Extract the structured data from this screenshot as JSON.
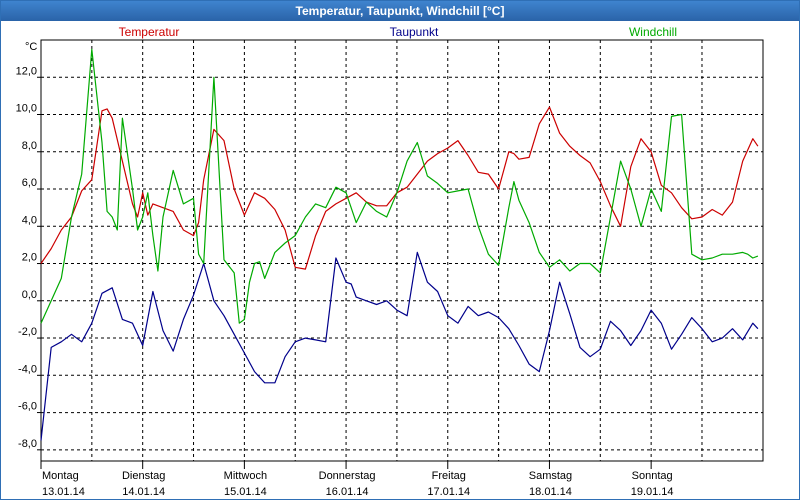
{
  "window": {
    "title": "Temperatur, Taupunkt, Windchill [°C]"
  },
  "chart_data": {
    "type": "line",
    "title": "Temperatur, Taupunkt, Windchill [°C]",
    "ylabel": "°C",
    "ylim": [
      -8.6,
      14.0
    ],
    "yticks": [
      "12,0",
      "10,0",
      "8,0",
      "6,0",
      "4,0",
      "2,0",
      "0,0",
      "-2,0",
      "-4,0",
      "-6,0",
      "-8,0"
    ],
    "ytick_values": [
      12,
      10,
      8,
      6,
      4,
      2,
      0,
      -2,
      -4,
      -6,
      -8
    ],
    "x_days": [
      "Montag",
      "Dienstag",
      "Mittwoch",
      "Donnerstag",
      "Freitag",
      "Samstag",
      "Sonntag"
    ],
    "x_dates": [
      "13.01.14",
      "14.01.14",
      "15.01.14",
      "16.01.14",
      "17.01.14",
      "18.01.14",
      "19.01.14"
    ],
    "xlim": [
      0,
      7.1
    ],
    "grid": true,
    "series": [
      {
        "name": "Temperatur",
        "color": "#cc0000",
        "x": [
          0,
          0.1,
          0.2,
          0.3,
          0.4,
          0.5,
          0.6,
          0.65,
          0.7,
          0.8,
          0.9,
          0.95,
          1.0,
          1.05,
          1.1,
          1.2,
          1.3,
          1.4,
          1.5,
          1.55,
          1.6,
          1.7,
          1.8,
          1.9,
          2.0,
          2.1,
          2.2,
          2.3,
          2.4,
          2.5,
          2.6,
          2.7,
          2.8,
          2.9,
          3.0,
          3.1,
          3.2,
          3.3,
          3.4,
          3.5,
          3.6,
          3.7,
          3.8,
          3.9,
          4.0,
          4.1,
          4.2,
          4.3,
          4.4,
          4.5,
          4.6,
          4.65,
          4.7,
          4.8,
          4.9,
          5.0,
          5.1,
          5.2,
          5.3,
          5.4,
          5.5,
          5.6,
          5.7,
          5.8,
          5.9,
          6.0,
          6.1,
          6.2,
          6.3,
          6.4,
          6.5,
          6.6,
          6.7,
          6.8,
          6.9,
          7.0,
          7.05
        ],
        "y": [
          2.0,
          2.8,
          3.8,
          4.5,
          5.9,
          6.5,
          10.2,
          10.3,
          9.8,
          7.5,
          5.2,
          4.5,
          5.8,
          4.6,
          5.2,
          5.0,
          4.8,
          3.8,
          3.5,
          4.2,
          6.5,
          9.2,
          8.6,
          6.0,
          4.6,
          5.8,
          5.5,
          4.9,
          3.8,
          1.8,
          1.7,
          3.5,
          4.8,
          5.2,
          5.5,
          5.8,
          5.3,
          5.1,
          5.1,
          5.8,
          6.1,
          6.8,
          7.5,
          7.9,
          8.2,
          8.6,
          7.8,
          6.9,
          6.8,
          6.0,
          8.0,
          7.9,
          7.6,
          7.7,
          9.5,
          10.4,
          9.0,
          8.3,
          7.8,
          7.4,
          6.4,
          5.1,
          4.0,
          7.2,
          8.7,
          8.0,
          6.2,
          5.8,
          5.0,
          4.4,
          4.5,
          4.9,
          4.6,
          5.3,
          7.5,
          8.7,
          8.3
        ]
      },
      {
        "name": "Taupunkt",
        "color": "#00008b",
        "x": [
          0,
          0.1,
          0.2,
          0.3,
          0.4,
          0.5,
          0.6,
          0.7,
          0.8,
          0.9,
          1.0,
          1.1,
          1.2,
          1.3,
          1.4,
          1.5,
          1.6,
          1.7,
          1.8,
          1.9,
          2.0,
          2.1,
          2.2,
          2.3,
          2.4,
          2.5,
          2.6,
          2.7,
          2.8,
          2.9,
          3.0,
          3.05,
          3.1,
          3.2,
          3.3,
          3.4,
          3.5,
          3.6,
          3.7,
          3.8,
          3.9,
          4.0,
          4.05,
          4.1,
          4.2,
          4.3,
          4.4,
          4.5,
          4.6,
          4.7,
          4.8,
          4.9,
          5.0,
          5.1,
          5.2,
          5.3,
          5.4,
          5.5,
          5.6,
          5.7,
          5.8,
          5.9,
          6.0,
          6.1,
          6.2,
          6.3,
          6.4,
          6.5,
          6.6,
          6.7,
          6.8,
          6.9,
          7.0,
          7.05
        ],
        "y": [
          -7.5,
          -2.5,
          -2.2,
          -1.8,
          -2.2,
          -1.2,
          0.4,
          0.7,
          -1.0,
          -1.2,
          -2.4,
          0.5,
          -1.6,
          -2.7,
          -1.0,
          0.3,
          2.0,
          0.0,
          -0.8,
          -1.8,
          -2.8,
          -3.8,
          -4.4,
          -4.4,
          -3.0,
          -2.2,
          -2.0,
          -2.1,
          -2.2,
          2.3,
          1.0,
          0.9,
          0.2,
          0.0,
          -0.2,
          0.0,
          -0.5,
          -0.8,
          2.6,
          1.0,
          0.5,
          -0.8,
          -1.0,
          -1.2,
          -0.3,
          -0.8,
          -0.6,
          -0.9,
          -1.5,
          -2.4,
          -3.4,
          -3.8,
          -1.6,
          1.0,
          -0.7,
          -2.5,
          -3.0,
          -2.6,
          -1.1,
          -1.6,
          -2.4,
          -1.6,
          -0.5,
          -1.2,
          -2.6,
          -1.8,
          -0.9,
          -1.5,
          -2.2,
          -2.0,
          -1.5,
          -2.1,
          -1.2,
          -1.5
        ]
      },
      {
        "name": "Windchill",
        "color": "#00aa00",
        "x": [
          0,
          0.1,
          0.2,
          0.3,
          0.4,
          0.5,
          0.6,
          0.65,
          0.7,
          0.75,
          0.8,
          0.9,
          0.95,
          1.0,
          1.05,
          1.1,
          1.15,
          1.2,
          1.3,
          1.4,
          1.5,
          1.55,
          1.6,
          1.7,
          1.8,
          1.9,
          1.95,
          2.0,
          2.05,
          2.1,
          2.15,
          2.2,
          2.3,
          2.4,
          2.5,
          2.6,
          2.7,
          2.8,
          2.9,
          3.0,
          3.1,
          3.2,
          3.3,
          3.4,
          3.5,
          3.6,
          3.7,
          3.8,
          3.9,
          4.0,
          4.1,
          4.2,
          4.3,
          4.4,
          4.5,
          4.6,
          4.65,
          4.7,
          4.8,
          4.9,
          5.0,
          5.1,
          5.2,
          5.3,
          5.4,
          5.5,
          5.6,
          5.7,
          5.8,
          5.9,
          6.0,
          6.1,
          6.2,
          6.3,
          6.4,
          6.5,
          6.6,
          6.7,
          6.8,
          6.9,
          6.95,
          7.0,
          7.05
        ],
        "y": [
          -1.2,
          0.0,
          1.2,
          4.5,
          6.8,
          13.5,
          8.5,
          4.8,
          4.5,
          3.8,
          9.8,
          6.0,
          3.8,
          4.5,
          5.8,
          3.5,
          1.6,
          4.5,
          7.0,
          5.2,
          5.5,
          2.5,
          2.0,
          12.0,
          2.2,
          1.5,
          -1.2,
          -1.0,
          1.0,
          2.0,
          2.1,
          1.2,
          2.6,
          3.1,
          3.5,
          4.5,
          5.2,
          5.0,
          6.1,
          5.8,
          4.2,
          5.3,
          4.8,
          4.5,
          5.8,
          7.5,
          8.5,
          6.7,
          6.3,
          5.8,
          5.9,
          6.0,
          4.0,
          2.5,
          1.9,
          5.0,
          6.4,
          5.4,
          4.2,
          2.6,
          1.8,
          2.2,
          1.6,
          2.0,
          2.0,
          1.5,
          4.5,
          7.5,
          6.0,
          4.0,
          6.0,
          4.8,
          9.9,
          10.0,
          2.5,
          2.2,
          2.3,
          2.5,
          2.5,
          2.6,
          2.5,
          2.3,
          2.4
        ]
      }
    ]
  }
}
